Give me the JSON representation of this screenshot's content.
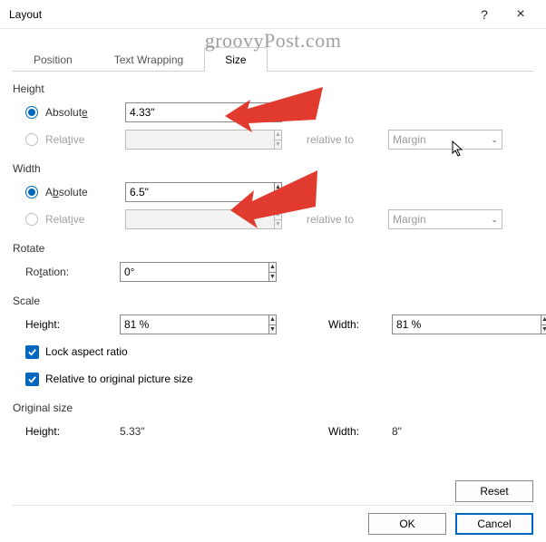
{
  "window": {
    "title": "Layout",
    "help_tip": "?",
    "close_tip": "×"
  },
  "watermark": "groovyPost.com",
  "tabs": {
    "position": "Position",
    "wrapping": "Text Wrapping",
    "size": "Size"
  },
  "height": {
    "section": "Height",
    "absolute_label": "Absolute",
    "absolute_value": "4.33\"",
    "relative_label": "Relative",
    "relative_value": "",
    "relative_to_label": "relative to",
    "relative_to_value": "Margin"
  },
  "width": {
    "section": "Width",
    "absolute_label": "Absolute",
    "absolute_value": "6.5\"",
    "relative_label": "Relative",
    "relative_value": "",
    "relative_to_label": "relative to",
    "relative_to_value": "Margin"
  },
  "rotate": {
    "section": "Rotate",
    "rotation_label": "Rotation:",
    "rotation_value": "0°"
  },
  "scale": {
    "section": "Scale",
    "height_label": "Height:",
    "height_value": "81 %",
    "width_label": "Width:",
    "width_value": "81 %",
    "lock_label": "Lock aspect ratio",
    "relative_orig_label": "Relative to original picture size"
  },
  "original": {
    "section": "Original size",
    "height_label": "Height:",
    "height_value": "5.33\"",
    "width_label": "Width:",
    "width_value": "8\""
  },
  "buttons": {
    "reset": "Reset",
    "ok": "OK",
    "cancel": "Cancel"
  }
}
